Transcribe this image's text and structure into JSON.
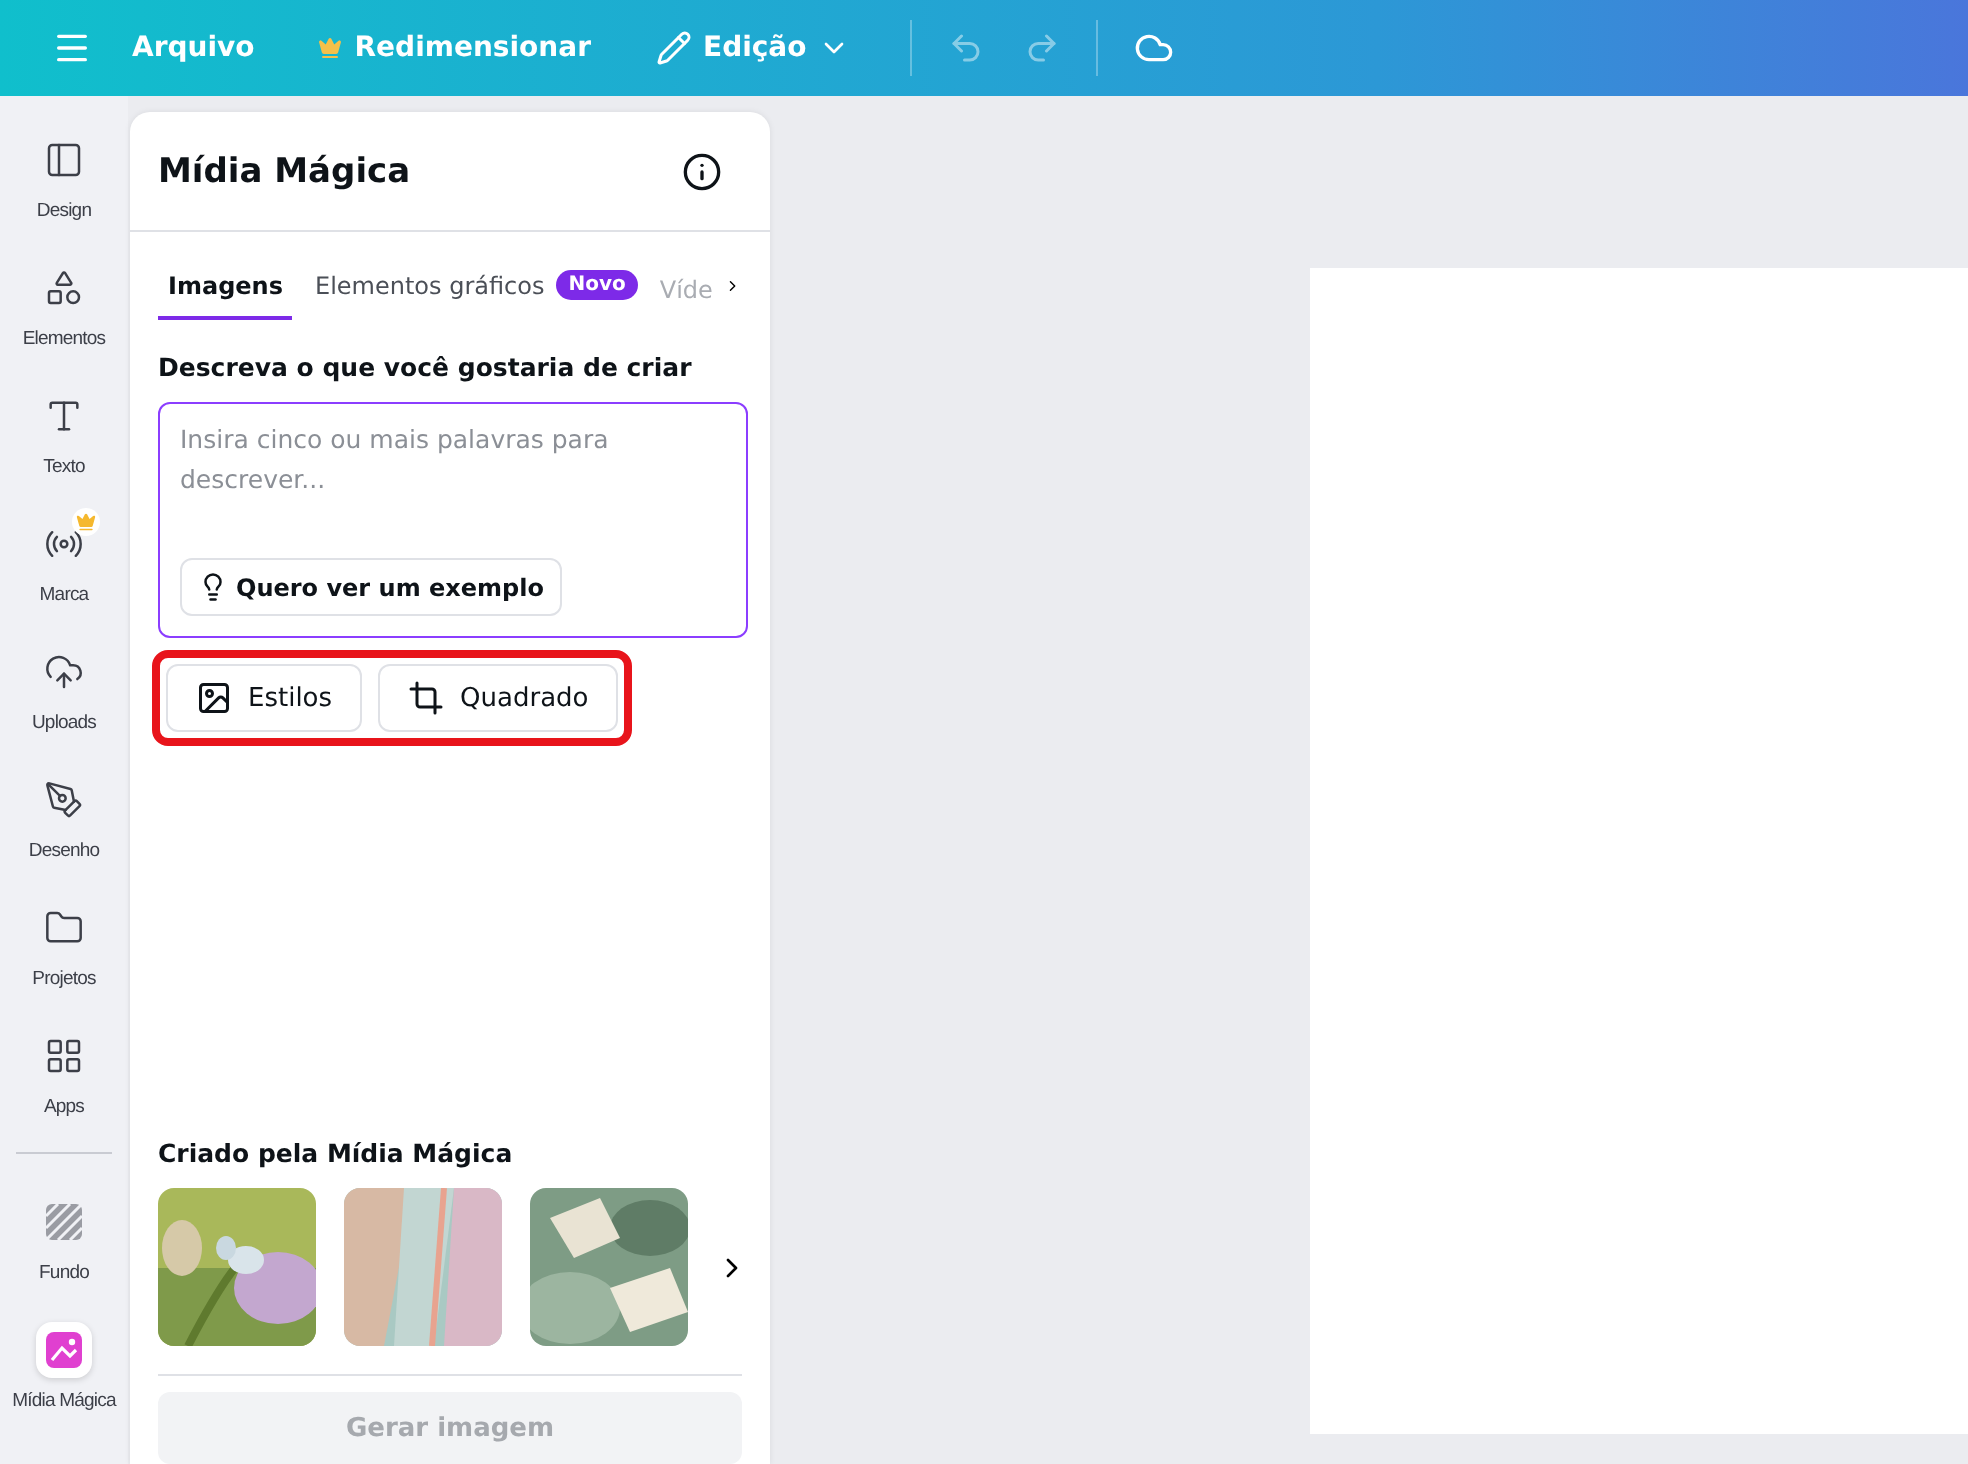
{
  "topbar": {
    "menu": "Arquivo",
    "resize": "Redimensionar",
    "mode": "Edição",
    "undo_disabled": true,
    "redo_disabled": true
  },
  "sidebar": {
    "items": [
      {
        "kind": "design",
        "label": "Design",
        "selected": false
      },
      {
        "kind": "elements",
        "label": "Elementos",
        "selected": false
      },
      {
        "kind": "text",
        "label": "Texto",
        "selected": false
      },
      {
        "kind": "brand",
        "label": "Marca",
        "selected": false,
        "premium": true
      },
      {
        "kind": "uploads",
        "label": "Uploads",
        "selected": false
      },
      {
        "kind": "draw",
        "label": "Desenho",
        "selected": false
      },
      {
        "kind": "projects",
        "label": "Projetos",
        "selected": false
      },
      {
        "kind": "apps",
        "label": "Apps",
        "selected": false
      },
      {
        "kind": "divider"
      },
      {
        "kind": "background",
        "label": "Fundo",
        "selected": false
      },
      {
        "kind": "magic",
        "label": "Mídia Mágica",
        "selected": true
      }
    ]
  },
  "panel": {
    "title": "Mídia Mágica",
    "tabs": [
      {
        "label": "Imagens",
        "selected": true
      },
      {
        "label": "Elementos gráficos",
        "selected": false,
        "badge": "Novo"
      },
      {
        "label": "Víde",
        "selected": false
      }
    ],
    "prompt_label": "Descreva o que você gostaria de criar",
    "prompt": {
      "placeholder": "Insira cinco ou mais palavras para descrever..."
    },
    "example_button": "Quero ver um exemplo",
    "options": {
      "highlighted": true,
      "buttons": [
        {
          "kind": "styles",
          "label": "Estilos"
        },
        {
          "kind": "shape",
          "label": "Quadrado"
        }
      ]
    },
    "gallery": {
      "title": "Criado pela Mídia Mágica"
    },
    "generate": {
      "label": "Gerar imagem",
      "disabled": true
    }
  }
}
